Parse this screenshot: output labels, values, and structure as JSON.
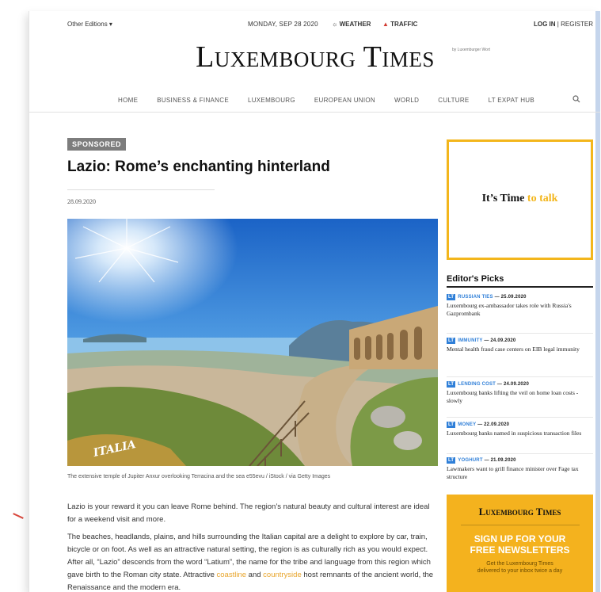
{
  "topbar": {
    "editions": "Other Editions ▾",
    "date": "MONDAY, SEP 28 2020",
    "weather": "WEATHER",
    "traffic": "TRAFFIC",
    "login": "LOG IN",
    "separator": "|",
    "register": "REGISTER"
  },
  "masthead": {
    "logo": "Luxembourg Times",
    "byline": "by Luxemburger Wort"
  },
  "nav": {
    "items": [
      "HOME",
      "BUSINESS & FINANCE",
      "LUXEMBOURG",
      "EUROPEAN UNION",
      "WORLD",
      "CULTURE",
      "LT EXPAT HUB"
    ]
  },
  "article": {
    "label": "SPONSORED",
    "headline": "Lazio: Rome’s enchanting hinterland",
    "date": "28.09.2020",
    "photo_watermark": "ITALIA",
    "caption": "The extensive temple of Jupiter Anxur overlooking Terracina and the sea e55evu / iStock / via Getty Images",
    "paragraph1": "Lazio is your reward it you can leave Rome behind. The region’s natural beauty and cultural interest are ideal for a weekend visit and more.",
    "paragraph2_a": "The beaches, headlands, plains, and hills surrounding the Italian capital are a delight to explore by car, train, bicycle or on foot. As well as an attractive natural setting, the region is as culturally rich as you would expect. After all, “Lazio” descends from the word “Latium”, the name for the tribe and language from this region which gave birth to the Roman city state. Attractive ",
    "link1": "coastline",
    "paragraph2_b": " and ",
    "link2": "countryside",
    "paragraph2_c": " host remnants of the ancient world, the Renaissance and the modern era."
  },
  "ad": {
    "text_a": "It’s Time",
    "text_b": "to talk"
  },
  "editors_picks": {
    "title": "Editor's Picks",
    "badge": "LT",
    "items": [
      {
        "tag": "RUSSIAN TIES",
        "date": "— 25.09.2020",
        "title": "Luxembourg ex-ambassador takes role with Russia's Gazprombank"
      },
      {
        "tag": "IMMUNITY",
        "date": "— 24.09.2020",
        "title": "Mental health fraud case centers on EIB legal immunity"
      },
      {
        "tag": "LENDING COST",
        "date": "— 24.09.2020",
        "title": "Luxembourg banks lifting the veil on home loan costs - slowly"
      },
      {
        "tag": "MONEY",
        "date": "— 22.09.2020",
        "title": "Luxembourg banks named in suspicious transaction files"
      },
      {
        "tag": "YOGHURT",
        "date": "— 21.09.2020",
        "title": "Lawmakers want to grill finance minister over Fage tax structure"
      }
    ]
  },
  "newsletter": {
    "logo": "Luxembourg Times",
    "headline1": "SIGN UP FOR YOUR",
    "headline2": "FREE NEWSLETTERS",
    "sub1": "Get the Luxembourg Times",
    "sub2": "delivered to your inbox twice a day"
  },
  "colors": {
    "accent_yellow": "#f3b61c",
    "link_orange": "#e8a52c",
    "pick_blue": "#2f7fd8",
    "traffic_red": "#d23b32"
  }
}
